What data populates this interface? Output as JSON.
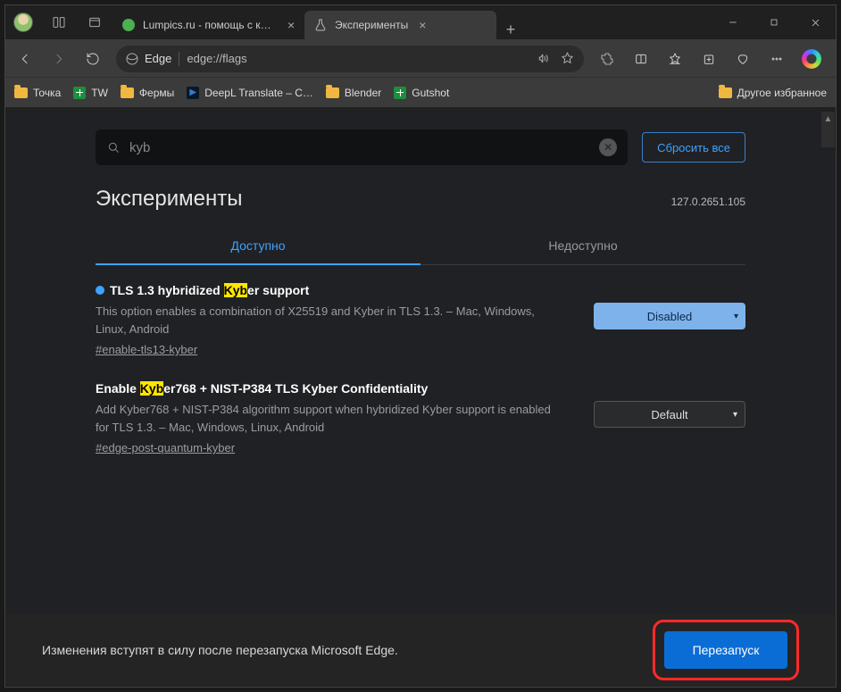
{
  "browser_tabs": [
    {
      "label": "Lumpics.ru - помощь с компью",
      "favicon": "green-circle"
    },
    {
      "label": "Эксперименты",
      "favicon": "flask"
    }
  ],
  "address_bar": {
    "browser_label": "Edge",
    "url": "edge://flags"
  },
  "bookmarks": [
    {
      "icon": "folder",
      "label": "Точка"
    },
    {
      "icon": "sheet",
      "label": "TW"
    },
    {
      "icon": "folder",
      "label": "Фермы"
    },
    {
      "icon": "deepl",
      "label": "DeepL Translate – C…"
    },
    {
      "icon": "folder",
      "label": "Blender"
    },
    {
      "icon": "sheet",
      "label": "Gutshot"
    }
  ],
  "other_bookmarks": "Другое избранное",
  "search": {
    "value": "kyb",
    "reset": "Сбросить все"
  },
  "page": {
    "title": "Эксперименты",
    "version": "127.0.2651.105"
  },
  "tabs": {
    "available": "Доступно",
    "unavailable": "Недоступно"
  },
  "flags": [
    {
      "title_pre": "TLS 1.3 hybridized ",
      "hl": "Kyb",
      "title_post": "er support",
      "desc": "This option enables a combination of X25519 and Kyber in TLS 1.3. – Mac, Windows, Linux, Android",
      "anchor": "#enable-tls13-kyber",
      "select": "Disabled",
      "modified": true
    },
    {
      "title_pre": "Enable ",
      "hl": "Kyb",
      "title_post": "er768 + NIST-P384 TLS Kyber Confidentiality",
      "desc": "Add Kyber768 + NIST-P384 algorithm support when hybridized Kyber support is enabled for TLS 1.3. – Mac, Windows, Linux, Android",
      "anchor": "#edge-post-quantum-kyber",
      "select": "Default",
      "modified": false
    }
  ],
  "footer": {
    "message": "Изменения вступят в силу после перезапуска Microsoft Edge.",
    "button": "Перезапуск"
  }
}
